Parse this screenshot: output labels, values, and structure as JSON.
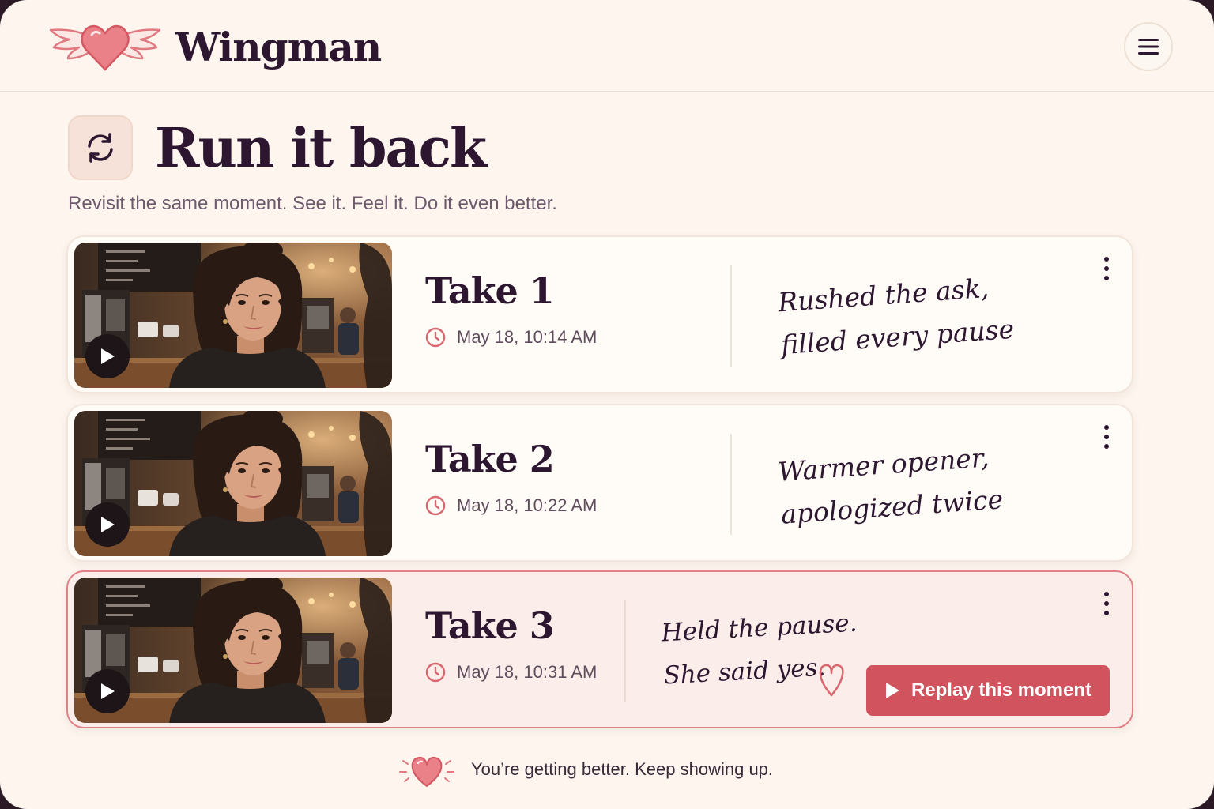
{
  "app": {
    "brand": "Wingman",
    "logo_icon": "winged-heart-icon",
    "menu_icon": "hamburger-icon"
  },
  "page": {
    "title": "Run it back",
    "title_icon": "refresh-icon",
    "subtitle": "Revisit the same moment. See it. Feel it. Do it even better."
  },
  "takes": [
    {
      "title": "Take 1",
      "time": "May 18, 10:14 AM",
      "note_line1": "Rushed the ask,",
      "note_line2": "filled every pause",
      "active": false
    },
    {
      "title": "Take 2",
      "time": "May 18, 10:22 AM",
      "note_line1": "Warmer opener,",
      "note_line2": "apologized twice",
      "active": false
    },
    {
      "title": "Take 3",
      "time": "May 18, 10:31 AM",
      "note_line1": "Held the pause.",
      "note_line2": "She said yes.",
      "active": true,
      "action_label": "Replay this moment"
    }
  ],
  "footer": {
    "text": "You’re getting better. Keep showing up.",
    "icon": "heart-sparkle-icon"
  },
  "colors": {
    "background": "#fdf5ee",
    "text": "#2d1630",
    "accent": "#d0535d",
    "active_border": "#e37f86",
    "active_card": "#fbede9"
  }
}
